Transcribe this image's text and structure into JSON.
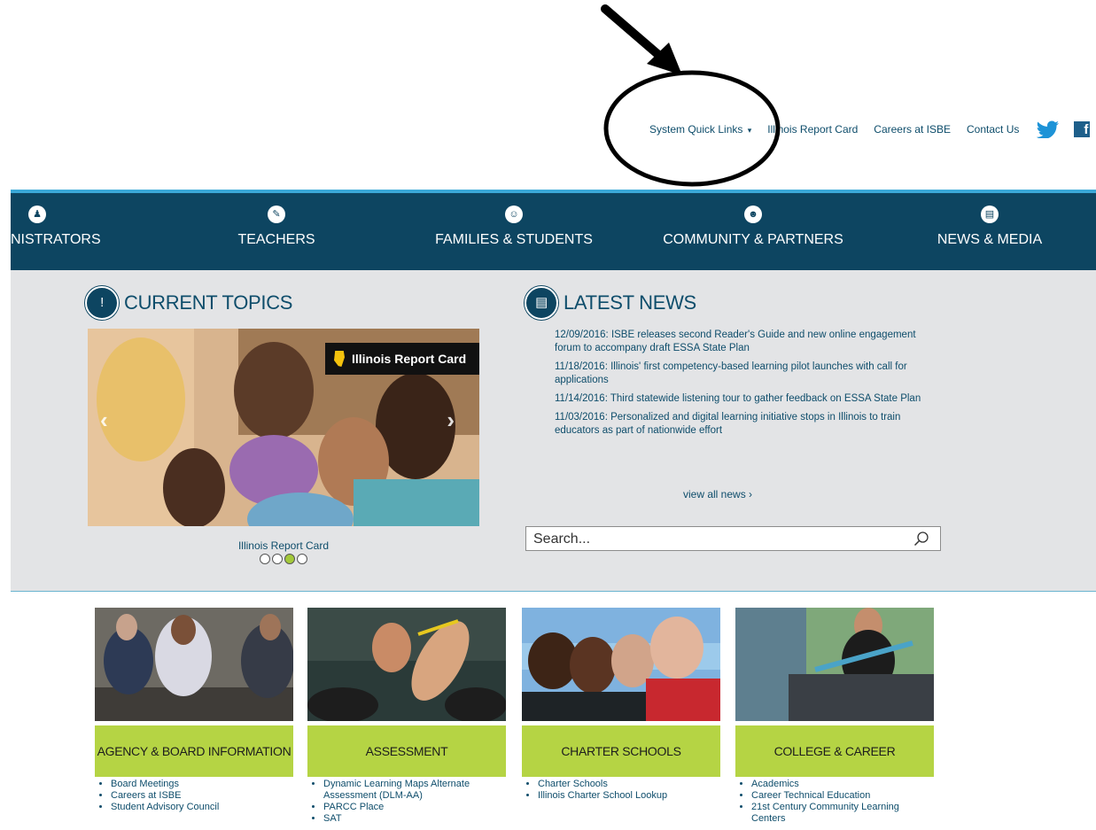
{
  "utility_links": {
    "quick_links": "System Quick Links",
    "report_card": "Illinois Report Card",
    "careers": "Careers at ISBE",
    "contact": "Contact Us",
    "twitter_icon": "twitter-icon",
    "facebook_icon": "facebook-icon"
  },
  "nav": {
    "items": [
      {
        "label": "ADMINISTRATORS",
        "icon": "administrator-icon"
      },
      {
        "label": "TEACHERS",
        "icon": "teacher-icon"
      },
      {
        "label": "FAMILIES & STUDENTS",
        "icon": "family-icon"
      },
      {
        "label": "COMMUNITY & PARTNERS",
        "icon": "community-icon"
      },
      {
        "label": "NEWS & MEDIA",
        "icon": "news-icon"
      }
    ]
  },
  "current_topics": {
    "title": "CURRENT TOPICS",
    "badge": "Illinois Report Card",
    "caption": "Illinois Report Card",
    "slide_count": 4,
    "active_slide": 3
  },
  "latest_news": {
    "title": "LATEST NEWS",
    "items": [
      "12/09/2016:  ISBE releases second Reader's Guide and new online engagement forum to accompany draft ESSA State Plan",
      "11/18/2016:  Illinois' first competency-based learning pilot launches with call for applications",
      "11/14/2016:  Third statewide listening tour to gather feedback on ESSA State Plan",
      "11/03/2016:  Personalized and digital learning initiative stops in Illinois to train educators as part of nationwide effort"
    ],
    "view_all": "view all news  ›"
  },
  "search": {
    "placeholder": "Search..."
  },
  "cards": [
    {
      "label": "AGENCY & BOARD INFORMATION",
      "links": [
        "Board Meetings",
        "Careers at ISBE",
        "Student Advisory Council"
      ]
    },
    {
      "label": "ASSESSMENT",
      "links": [
        "Dynamic Learning Maps Alternate Assessment (DLM-AA)",
        "PARCC Place",
        "SAT"
      ]
    },
    {
      "label": "CHARTER SCHOOLS",
      "links": [
        "Charter Schools",
        "Illinois Charter School Lookup"
      ]
    },
    {
      "label": "COLLEGE & CAREER",
      "links": [
        "Academics",
        "Career Technical Education",
        "21st Century Community Learning Centers"
      ]
    }
  ],
  "colors": {
    "nav_bg": "#0d4561",
    "accent_green": "#b5d444",
    "link_blue": "#0e4d6b",
    "band_bg": "#e3e4e6"
  }
}
